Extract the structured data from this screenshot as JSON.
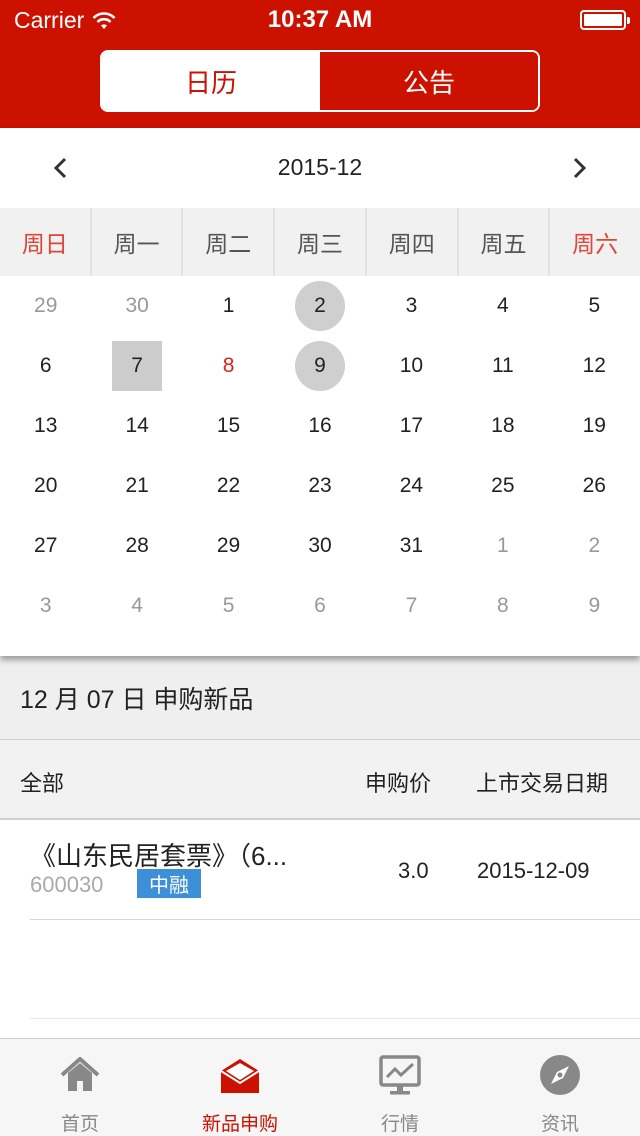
{
  "status_bar": {
    "carrier": "Carrier",
    "time": "10:37 AM"
  },
  "segments": [
    {
      "label": "日历",
      "active": true
    },
    {
      "label": "公告",
      "active": false
    }
  ],
  "calendar": {
    "month": "2015-12",
    "weekdays": [
      "周日",
      "周一",
      "周二",
      "周三",
      "周四",
      "周五",
      "周六"
    ],
    "days": [
      [
        "29",
        "30",
        "1",
        "2",
        "3",
        "4",
        "5"
      ],
      [
        "6",
        "7",
        "8",
        "9",
        "10",
        "11",
        "12"
      ],
      [
        "13",
        "14",
        "15",
        "16",
        "17",
        "18",
        "19"
      ],
      [
        "20",
        "21",
        "22",
        "23",
        "24",
        "25",
        "26"
      ],
      [
        "27",
        "28",
        "29",
        "30",
        "31",
        "1",
        "2"
      ],
      [
        "3",
        "4",
        "5",
        "6",
        "7",
        "8",
        "9"
      ]
    ]
  },
  "section": {
    "title": "12 月 07 日 申购新品"
  },
  "table": {
    "headers": {
      "all": "全部",
      "price": "申购价",
      "date": "上市交易日期"
    },
    "rows": [
      {
        "name": "《山东民居套票》（6...",
        "code": "600030",
        "tag": "中融",
        "price": "3.0",
        "date": "2015-12-09"
      }
    ]
  },
  "tabbar": [
    {
      "label": "首页",
      "icon": "home-icon",
      "active": false
    },
    {
      "label": "新品申购",
      "icon": "envelope-icon",
      "active": true
    },
    {
      "label": "行情",
      "icon": "chart-monitor-icon",
      "active": false
    },
    {
      "label": "资讯",
      "icon": "compass-icon",
      "active": false
    }
  ],
  "colors": {
    "brand_red": "#cc1100",
    "weekend_red": "#e0443a",
    "tag_blue": "#3d8fd8"
  }
}
